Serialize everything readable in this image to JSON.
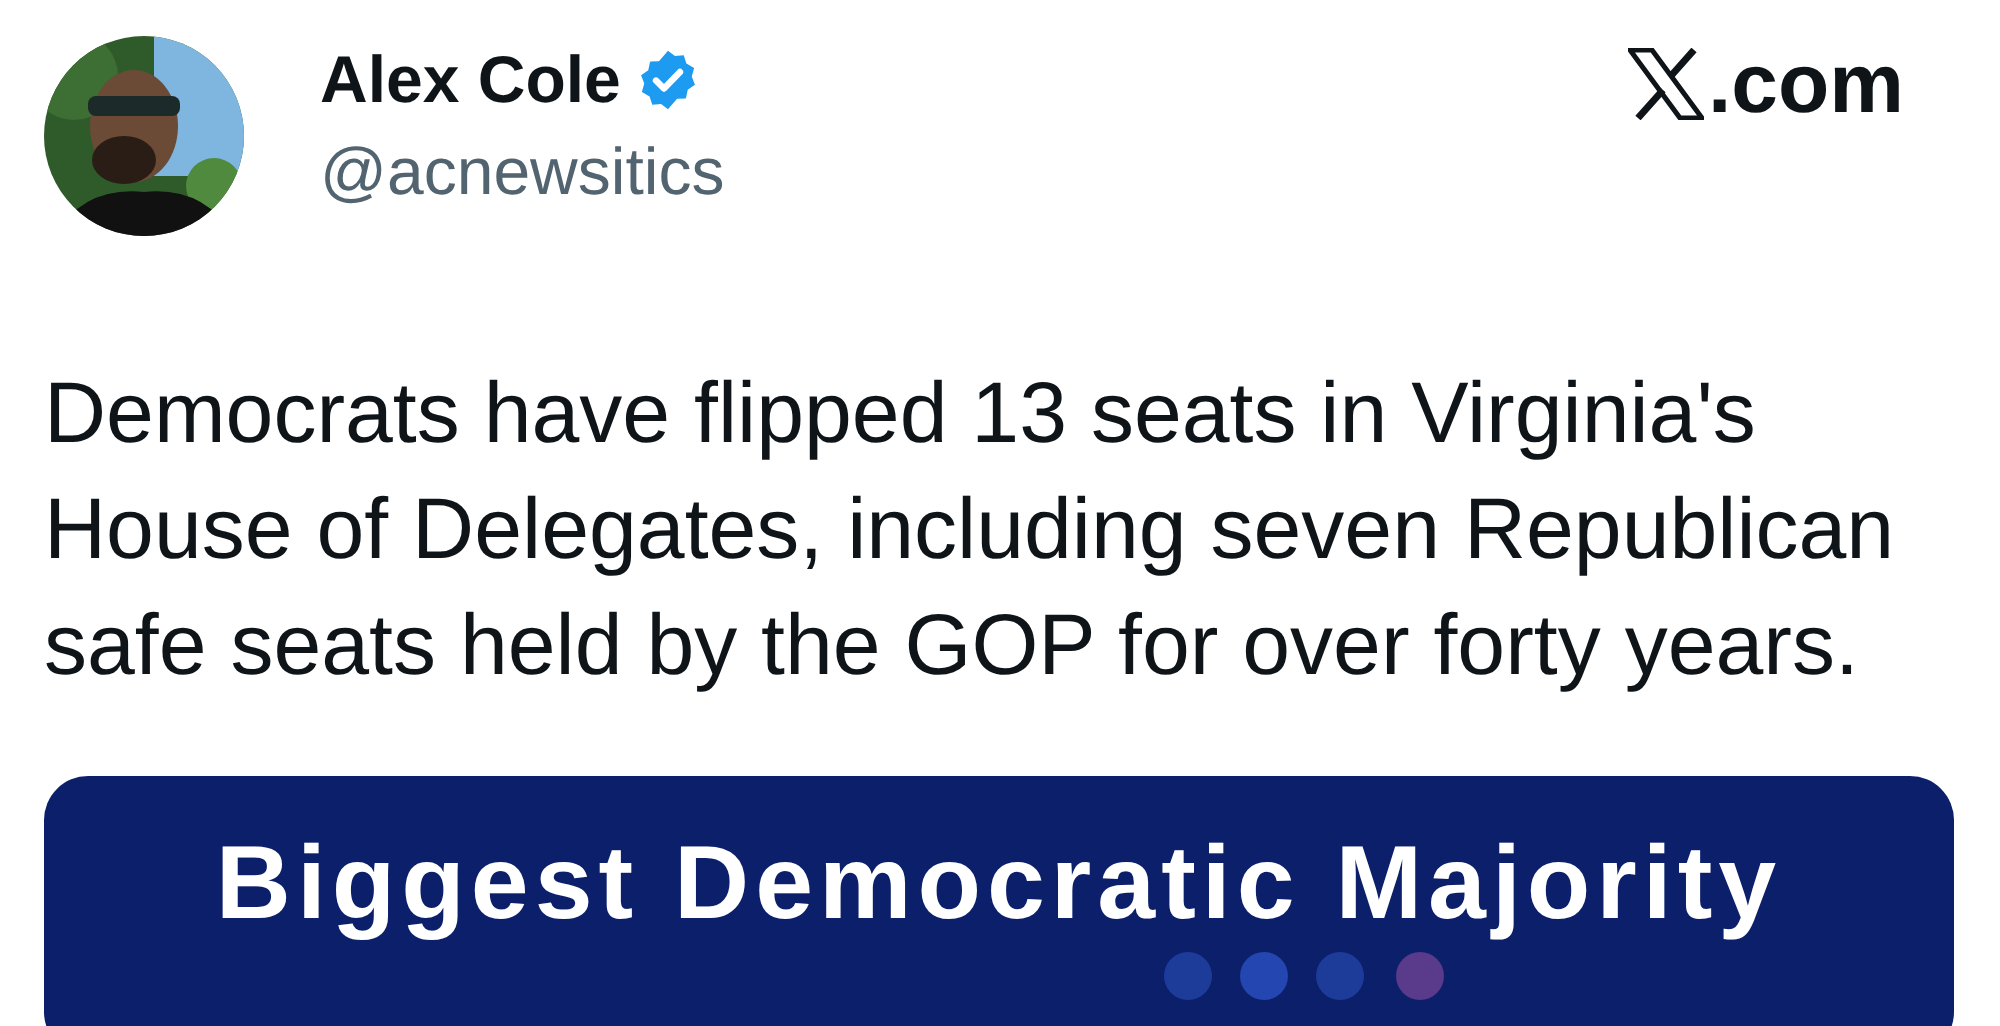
{
  "author": {
    "name": "Alex Cole",
    "verified": true,
    "handle": "@acnewsitics"
  },
  "source": {
    "domain": ".com"
  },
  "tweet": {
    "text": "Democrats have flipped 13 seats in Virginia's House of Delegates, including seven Republican safe seats held by the GOP for over forty years."
  },
  "image_card": {
    "heading": "Biggest Democratic Majority"
  }
}
